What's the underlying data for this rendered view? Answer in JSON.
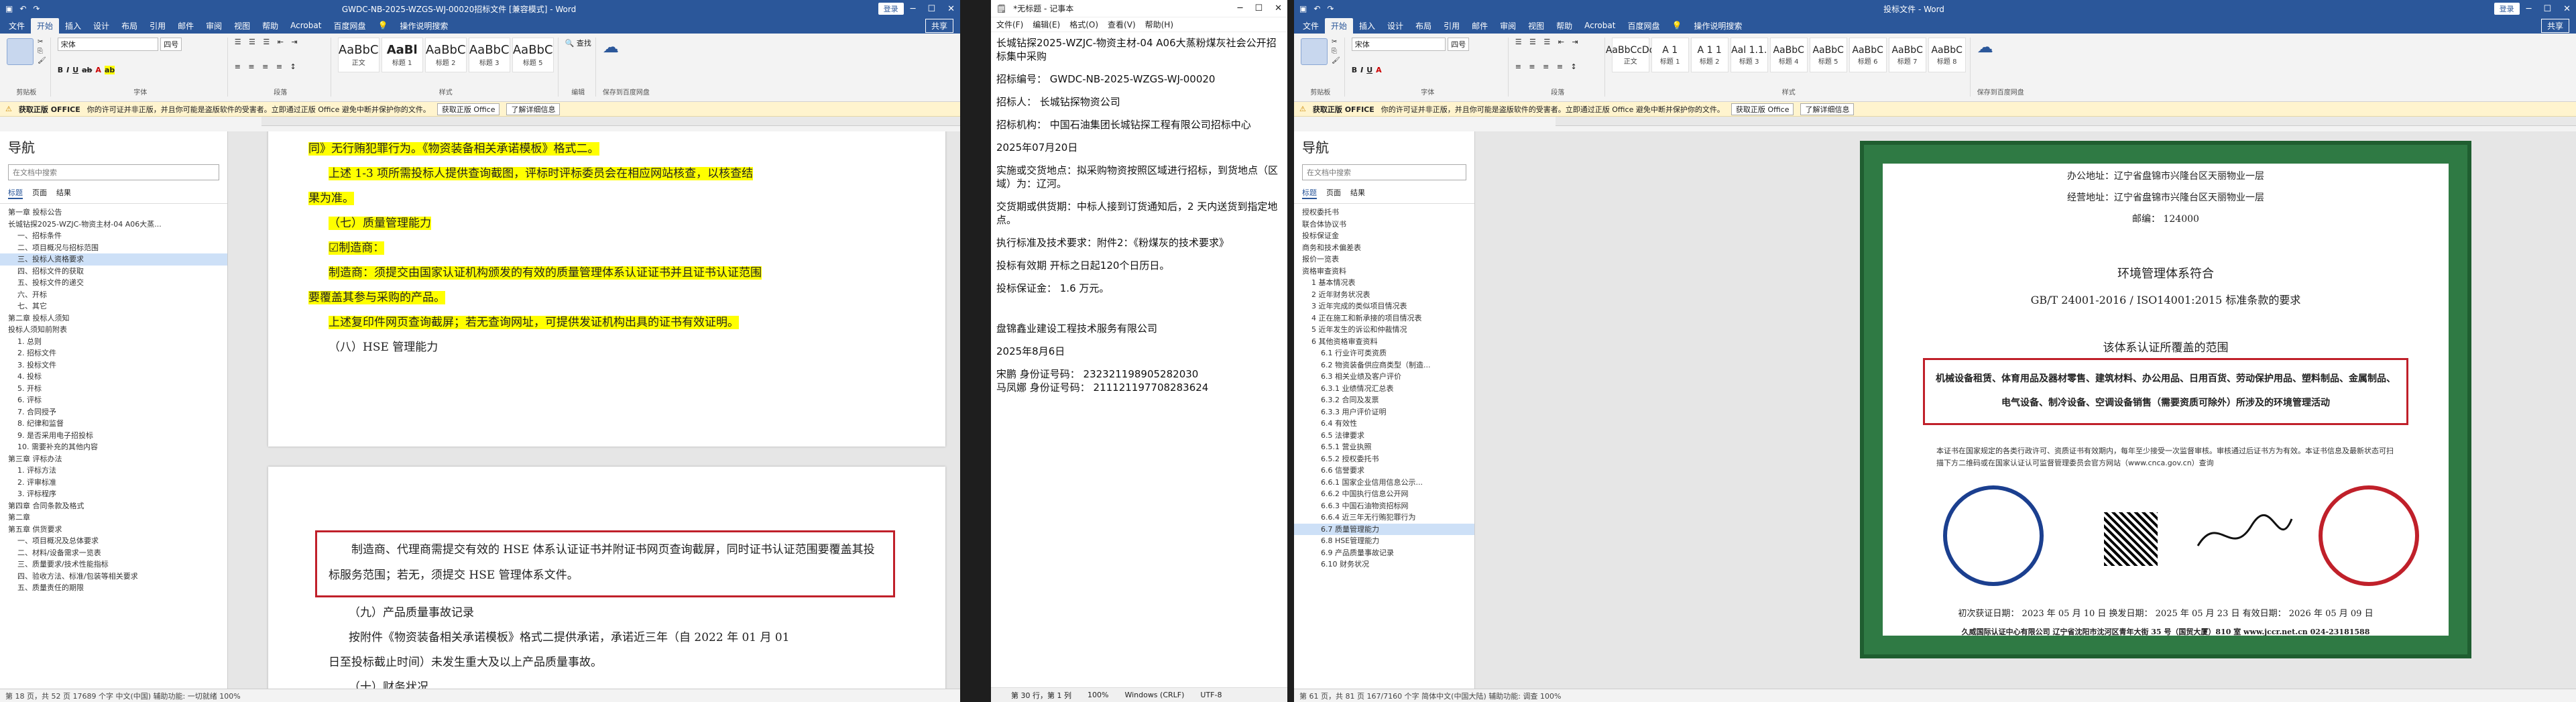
{
  "word1": {
    "title": "GWDC-NB-2025-WZGS-WJ-00020招标文件 [兼容模式] - Word",
    "account": "登录",
    "tabs": [
      "文件",
      "开始",
      "插入",
      "设计",
      "布局",
      "引用",
      "邮件",
      "审阅",
      "视图",
      "帮助",
      "Acrobat",
      "百度网盘"
    ],
    "search": "操作说明搜索",
    "share": "共享",
    "font_name": "宋体",
    "font_size": "四号",
    "styles": [
      "AaBbC",
      "AaBl",
      "AaBbC",
      "AaBbC",
      "AaBbC"
    ],
    "style_names": [
      "正文",
      "标题 1",
      "标题 2",
      "标题 3",
      "标题 5"
    ],
    "groups": [
      "剪贴板",
      "字体",
      "段落",
      "样式",
      "编辑",
      "保存到百度网盘"
    ],
    "paste_label": "粘贴",
    "info_bold": "获取正版 OFFICE",
    "info_text": "你的许可证并非正版，并且你可能是盗版软件的受害者。立即通过正版 Office 避免中断并保护你的文件。",
    "info_btn1": "获取正版 Office",
    "info_btn2": "了解详细信息",
    "nav_title": "导航",
    "nav_search": "在文档中搜索",
    "nav_tabs": [
      "标题",
      "页面",
      "结果"
    ],
    "tree": [
      "第一章 投标公告",
      "长城钻探2025-WZJC-物资主材-04 A06大蒸...",
      "一、招标条件",
      "二、项目概况与招标范围",
      "三、投标人资格要求",
      "四、招标文件的获取",
      "五、投标文件的递交",
      "六、开标",
      "七、其它",
      "第二章 投标人须知",
      "投标人须知前附表",
      "1. 总则",
      "2. 招标文件",
      "3. 投标文件",
      "4. 投标",
      "5. 开标",
      "6. 评标",
      "7. 合同授予",
      "8. 纪律和监督",
      "9. 是否采用电子招投标",
      "10. 需要补充的其他内容",
      "第三章 评标办法",
      "1. 评标方法",
      "2. 评审标准",
      "3. 评标程序",
      "第四章 合同条款及格式",
      "第二章",
      "第五章 供货要求",
      "一、项目概况及总体要求",
      "二、材料/设备需求一览表",
      "三、质量要求/技术性能指标",
      "四、验收方法、标准/包装等相关要求",
      "五、质量责任的期限"
    ],
    "tree_hl": 4,
    "page1": [
      "同》无行贿犯罪行为。《物资装备相关承诺模板》格式二。",
      "上述 1-3 项所需投标人提供查询截图，评标时评标委员会在相应网站核查，以核查结",
      "果为准。",
      "（七）质量管理能力",
      "☑制造商：",
      "制造商：须提交由国家认证机构颁发的有效的质量管理体系认证证书并且证书认证范围",
      "要覆盖其参与采购的产品。",
      "上述复印件网页查询截屏；若无查询网址，可提供发证机构出具的证书有效证明。",
      "（八）HSE 管理能力"
    ],
    "page2_box": "制造商、代理商需提交有效的 HSE 体系认证证书并附证书网页查询截屏，同时证书认证范围要覆盖其投标服务范围；若无，须提交 HSE 管理体系文件。",
    "page2_lines": [
      "（九）产品质量事故记录",
      "按附件《物资装备相关承诺模板》格式二提供承诺，承诺近三年（自 2022 年 01 月 01",
      "日至投标截止时间）未发生重大及以上产品质量事故。",
      "（十）财务状况"
    ],
    "status": "第 18 页，共 52 页    17689 个字    中文(中国)    辅助功能: 一切就绪    100%"
  },
  "notepad": {
    "title": "*无标题 - 记事本",
    "menu": [
      "文件(F)",
      "编辑(E)",
      "格式(O)",
      "查看(V)",
      "帮助(H)"
    ],
    "lines": [
      "长城钻探2025-WZJC-物资主材-04 A06大蒸粉煤灰社会公开招标集中采购",
      "招标编号：  GWDC-NB-2025-WZGS-WJ-00020",
      "招标人：  长城钻探物资公司",
      "招标机构：  中国石油集团长城钻探工程有限公司招标中心",
      "2025年07月20日",
      "实施或交货地点：拟采购物资按照区域进行招标，到货地点（区域）为：辽河。",
      "交货期或供货期：中标人接到订货通知后，2 天内送货到指定地点。",
      "执行标准及技术要求：附件2：《粉煤灰的技术要求》",
      "投标有效期  开标之日起120个日历日。",
      "投标保证金：  1.6  万元。",
      "盘锦鑫业建设工程技术服务有限公司",
      "2025年8月6日",
      "宋鹏   身份证号码：  232321198905282030",
      "马凤娜  身份证号码：  211121197708283624"
    ],
    "status": [
      "第 30 行，第 1 列",
      "100%",
      "Windows (CRLF)",
      "UTF-8"
    ]
  },
  "word2": {
    "title": "投标文件 - Word",
    "account": "登录",
    "styles": [
      "AaBbCcDd",
      "A 1",
      "A 1 1",
      "Aal 1.1.",
      "AaBbC",
      "AaBbC",
      "AaBbC",
      "AaBbC",
      "AaBbC",
      "AaBbC"
    ],
    "style_names": [
      "正文",
      "标题 1",
      "标题 2",
      "标题 3",
      "标题 4",
      "标题 5",
      "标题 6",
      "标题 7",
      "标题 8",
      "标题 9"
    ],
    "tree": [
      "授权委托书",
      "联合体协议书",
      "投标保证金",
      "商务和技术偏差表",
      "报价一览表",
      "资格审查资料",
      "1 基本情况表",
      "2 近年财务状况表",
      "3 近年完成的类似项目情况表",
      "4 正在施工和新承接的项目情况表",
      "5 近年发生的诉讼和仲裁情况",
      "6 其他资格审查资料",
      "6.1 行业许可类资质",
      "6.2 物资装备供应商类型（制造...",
      "6.3 相关业绩及客户评价",
      "6.3.1 业绩情况汇总表",
      "6.3.2 合同及发票",
      "6.3.3 用户评价证明",
      "6.4 有效性",
      "6.5 法律要求",
      "6.5.1 营业执照",
      "6.5.2 授权委托书",
      "6.6 信誉要求",
      "6.6.1 国家企业信用信息公示...",
      "6.6.2 中国执行信息公开网",
      "6.6.3 中国石油物资招标网",
      "6.6.4 近三年无行贿犯罪行为",
      "6.7 质量管理能力",
      "6.8 HSE管理能力",
      "6.9 产品质量事故记录",
      "6.10 财务状况"
    ],
    "tree_hl": 27,
    "status": "第 61 页，共 81 页    167/7160 个字    简体中文(中国大陆)    辅助功能: 调查    100%"
  },
  "cert": {
    "addr_label": "办公地址：辽宁省盘锦市兴隆台区天丽物业一层",
    "biz_label": "经营地址：辽宁省盘锦市兴隆台区天丽物业一层",
    "zip": "邮编：  124000",
    "system": "环境管理体系符合",
    "standard": "GB/T 24001-2016 / ISO14001:2015 标准条款的要求",
    "scope_title": "该体系认证所覆盖的范围",
    "scope": "机械设备租赁、体育用品及器材零售、建筑材料、办公用品、日用百货、劳动保护用品、塑料制品、金属制品、电气设备、制冷设备、空调设备销售（需要资质可除外）所涉及的环境管理活动",
    "note": "本证书在国家规定的各类行政许可、资质证书有效期内，每年至少接受一次监督审核。审核通过后证书方为有效。本证书信息及最新状态可扫描下方二维码或在国家认证认可监督管理委员会官方网站（www.cnca.gov.cn）查询",
    "dates": "初次获证日期： 2023 年 05 月 10 日    换发日期： 2025 年 05 月 23 日    有效日期： 2026 年 05 月 09 日",
    "footer": "久威国际认证中心有限公司  辽宁省沈阳市沈河区青年大街 35 号（国贸大厦）810 室 www.jccr.net.cn  024-23181588"
  }
}
